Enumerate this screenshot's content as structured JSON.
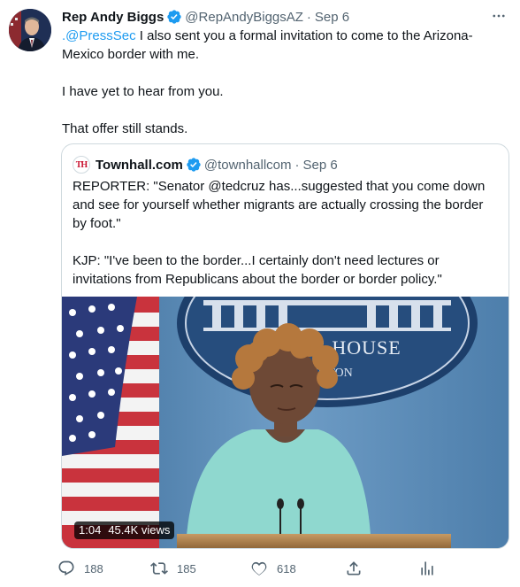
{
  "author": {
    "name": "Rep Andy Biggs",
    "handle": "@RepAndyBiggsAZ",
    "separator": "·",
    "date": "Sep 6"
  },
  "tweet": {
    "mention": ".@PressSec",
    "line1_rest": " I also sent you a formal invitation to come to the Arizona-",
    "line2": "Mexico border with me.",
    "line3": "I have yet to hear from you.",
    "line4": "That offer still stands."
  },
  "quote": {
    "name": "Townhall.com",
    "handle": "@townhallcom",
    "separator": "·",
    "date": "Sep 6",
    "logo_text": "TH",
    "para1_line1": "REPORTER: \"Senator @tedcruz has...suggested that you come down",
    "para1_line2": "and see for yourself whether migrants are actually crossing the border",
    "para1_line3": "by foot.\"",
    "para2_line1": "KJP: \"I've been to the border...I certainly don't need lectures or",
    "para2_line2": "invitations from Republicans about the border or border policy.\"",
    "video": {
      "duration": "1:04",
      "views": "45.4K views",
      "backdrop_text_1": "TE HOUSE",
      "backdrop_text_2": "NGTON"
    }
  },
  "actions": {
    "replies": "188",
    "retweets": "185",
    "likes": "618"
  },
  "colors": {
    "accent": "#1d9bf0",
    "secondary_text": "#536471",
    "border": "#cfd9de"
  },
  "icons": [
    "verified-badge-icon",
    "more-icon",
    "reply-icon",
    "retweet-icon",
    "like-icon",
    "share-icon",
    "analytics-icon"
  ]
}
